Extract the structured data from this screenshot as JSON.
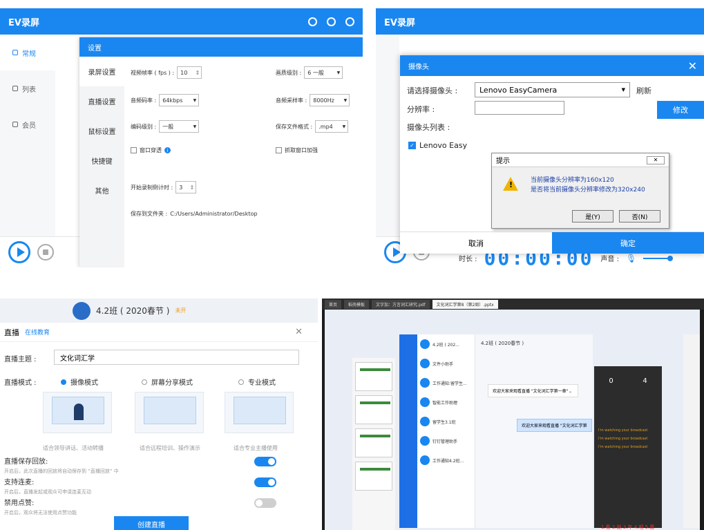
{
  "p1": {
    "app_title": "EV录屏",
    "sidebar": [
      "常规",
      "列表",
      "会员"
    ],
    "settings_title": "设置",
    "nav": [
      "录屏设置",
      "直播设置",
      "鼠标设置",
      "快捷键",
      "其他"
    ],
    "fps_label": "视频帧率 ( fps ) :",
    "fps_value": "10",
    "quality_label": "画质级别 :",
    "quality_value": "6 一般",
    "audio_bitrate_label": "音频码率 :",
    "audio_bitrate_value": "64kbps",
    "sample_rate_label": "音频采样率 :",
    "sample_rate_value": "8000Hz",
    "encode_label": "编码级别 :",
    "encode_value": "一般",
    "format_label": "保存文件格式 :",
    "format_value": ".mp4",
    "window_through": "窗口穿透",
    "capture_window": "抓取窗口加强",
    "countdown_label": "开始录制倒计时 :",
    "countdown_value": "3",
    "save_path_label": "保存到文件夹 :",
    "save_path": "C:/Users/Administrator/Desktop"
  },
  "p2": {
    "app_title": "EV录屏",
    "dialog_title": "摄像头",
    "select_camera_label": "请选择摄像头 :",
    "camera": "Lenovo EasyCamera",
    "refresh": "刷新",
    "resolution_label": "分辨率 :",
    "modify": "修改",
    "camera_list_label": "摄像头列表 :",
    "camera_list_item": "Lenovo Easy",
    "prompt_title": "提示",
    "prompt_line1": "当前摄像头分辨率为160x120",
    "prompt_line2": "是否将当前摄像头分辨率修改为320x240",
    "yes": "是(Y)",
    "no": "否(N)",
    "cancel": "取消",
    "confirm": "确定",
    "duration_label": "时长 :",
    "timer": "00:00:00",
    "volume_label": "声音 :"
  },
  "p3": {
    "class_name": "4.2班 ( 2020春节 )",
    "class_tag": "未开",
    "title": "直播",
    "subtitle": "在线教育",
    "topic_label": "直播主题 :",
    "topic_value": "文化词汇学",
    "mode_label": "直播模式 :",
    "modes": [
      "摄像模式",
      "屏幕分享模式",
      "专业模式"
    ],
    "captions": [
      "适合领导讲话、活动转播",
      "适合远程培训、操作演示",
      "适合专业主播使用"
    ],
    "opt1_title": "直播保存回放:",
    "opt1_desc": "开启后，此次直播的回放将自动保存到 “直播回放” 中",
    "opt2_title": "支持连麦:",
    "opt2_desc": "开启后，直播发起或观众可申请连麦互动",
    "opt3_title": "禁用点赞:",
    "opt3_desc": "开启后，观众将无法使用点赞功能",
    "create": "创建直播"
  },
  "p4": {
    "tabs": [
      "首页",
      "稻壳模板",
      "文字加：方言词汇研究.pdf",
      "文化词汇学第8（第2周）.pptx"
    ],
    "qq_items": [
      "4.2班 ( 202...",
      "文件小助手",
      "工作通知:留学生...",
      "智能工作助理",
      "留学生3.1班",
      "钉钉管理助手",
      "工作通知4.2班..."
    ],
    "chat_title": "4.2班 ( 2020春节 )",
    "chat_msg1": "欢迎大家来观看直播 \"文化词汇学第一章\" 。",
    "chat_msg2": "欢迎大家来观看直播 \"文化词汇学第",
    "live_count_left": "0",
    "live_count_right": "4",
    "live_msgs": [
      "I'm watching your broadcast",
      "I'm watching your broadcast",
      "I'm watching your broadcast"
    ],
    "ime_text": "1.看 2.就 3.年 4.吧 5.恩"
  }
}
